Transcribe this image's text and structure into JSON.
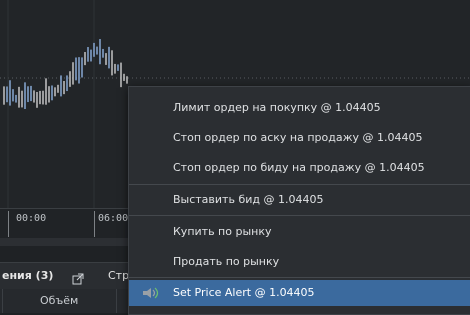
{
  "time_axis": {
    "labels": [
      "00:00",
      "06:00"
    ]
  },
  "panel": {
    "tab_positions": "ения (3)",
    "tab_orders": "Стр"
  },
  "table": {
    "volume_header": "Объём"
  },
  "context_menu": {
    "items": [
      {
        "label": "Лимит ордер на покупку @ 1.04405"
      },
      {
        "label": "Стоп ордер по аску на продажу @ 1.04405"
      },
      {
        "label": "Стоп ордер по биду на продажу @ 1.04405"
      },
      {
        "label": "Выставить бид @ 1.04405"
      },
      {
        "label": "Купить по рынку"
      },
      {
        "label": "Продать по рынку"
      },
      {
        "label": "Set Price Alert @ 1.04405"
      }
    ],
    "highlighted_index": 6
  },
  "colors": {
    "bar_up": "#8fb2e0",
    "bar_down": "#d0d0d0",
    "grid": "#5a5e63",
    "highlight": "#3b6a9e",
    "alert_icon": "#8a8f95"
  }
}
